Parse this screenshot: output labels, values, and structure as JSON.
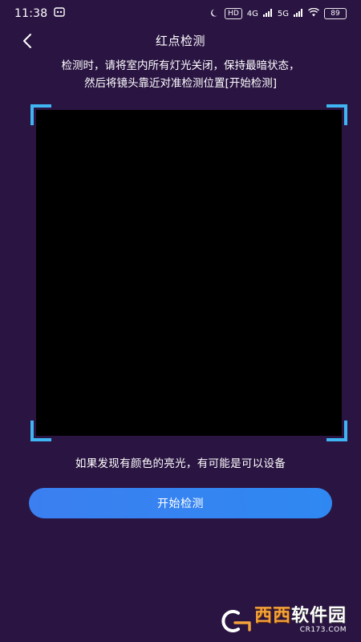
{
  "status_bar": {
    "time": "11:38",
    "network_badge": "HD",
    "signal_label_1": "4G",
    "signal_label_2": "5G",
    "battery": "89"
  },
  "header": {
    "title": "红点检测"
  },
  "instructions": {
    "line1": "检测时，请将室内所有灯光关闭，保持最暗状态，",
    "line2": "然后将镜头靠近对准检测位置[开始检测]"
  },
  "hint": {
    "text": "如果发现有颜色的亮光，有可能是可以设备"
  },
  "actions": {
    "start_label": "开始检测"
  },
  "watermark": {
    "brand_a": "西西",
    "brand_b": "软件园",
    "domain": "CR173.COM"
  },
  "colors": {
    "background": "#2a1442",
    "accent_corner": "#3fb6f3",
    "button": "#3184f1",
    "preview": "#000000"
  },
  "icons": {
    "back": "chevron-left-icon",
    "moon": "moon-icon",
    "wifi": "wifi-icon"
  }
}
